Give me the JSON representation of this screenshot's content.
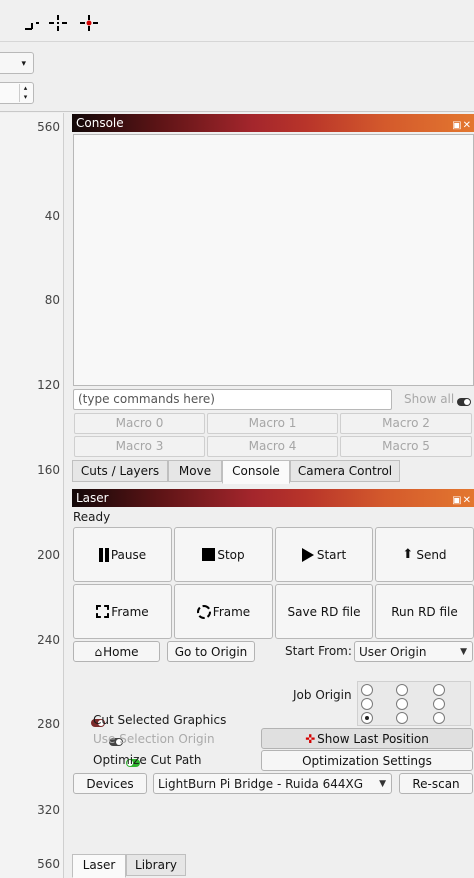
{
  "ruler": {
    "ticks": [
      "560",
      "40",
      "80",
      "120",
      "160",
      "200",
      "240",
      "280",
      "320",
      "560"
    ]
  },
  "console": {
    "title": "Console",
    "input_placeholder": "(type commands here)",
    "show_all_label": "Show all",
    "macros": [
      "Macro 0",
      "Macro 1",
      "Macro 2",
      "Macro 3",
      "Macro 4",
      "Macro 5"
    ]
  },
  "tabs": [
    "Cuts / Layers",
    "Move",
    "Console",
    "Camera Control"
  ],
  "laser": {
    "title": "Laser",
    "status": "Ready",
    "buttons": [
      "Pause",
      "Stop",
      "Start",
      "Send",
      "Frame",
      "Frame",
      "Save RD file",
      "Run RD file"
    ],
    "home_label": "Home",
    "go_origin_label": "Go to Origin",
    "start_from_label": "Start From:",
    "start_from_value": "User Origin",
    "job_origin_label": "Job Origin",
    "cut_selected_label": "Cut Selected Graphics",
    "use_selection_origin_label": "Use Selection Origin",
    "optimize_cut_label": "Optimize Cut Path",
    "show_last_position_label": "Show Last Position",
    "optimization_settings_label": "Optimization Settings",
    "devices_label": "Devices",
    "device_value": "LightBurn Pi Bridge - Ruida 644XG",
    "rescan_label": "Re-scan"
  },
  "bottom_tabs": [
    "Laser",
    "Library"
  ],
  "colors": {
    "toggle_off": "#7a2a2a",
    "toggle_on": "#2fb52f"
  }
}
